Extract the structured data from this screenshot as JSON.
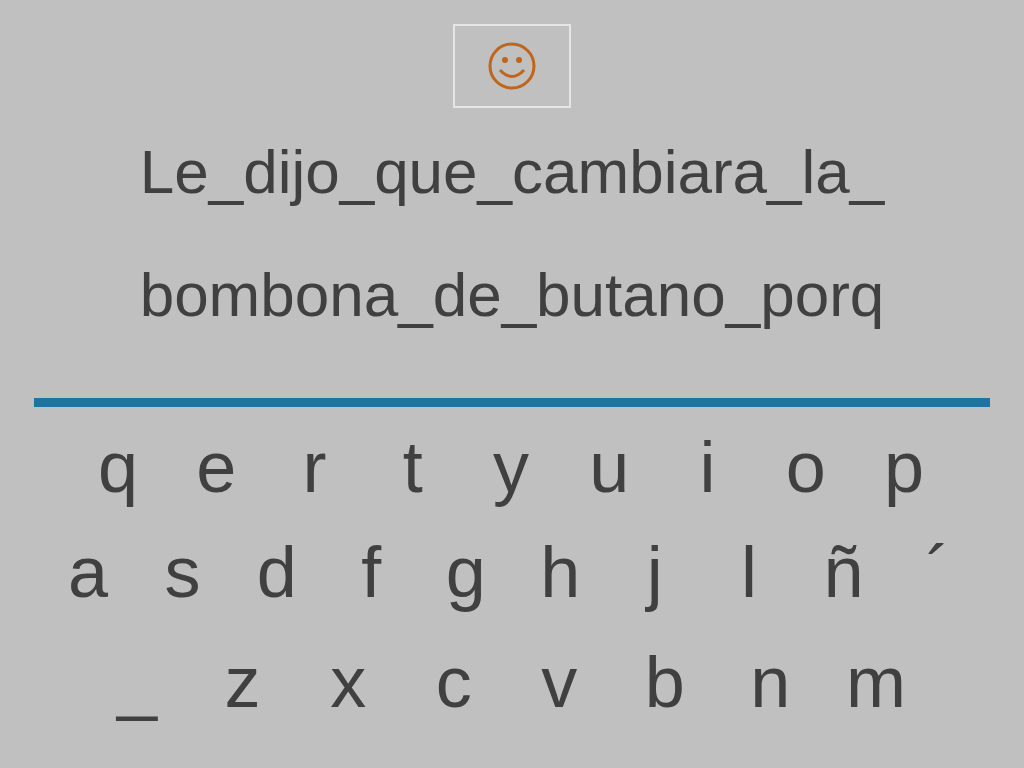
{
  "sentence_lines": [
    "Le_dijo_que_cambiara_la_",
    "bombona_de_butano_porq"
  ],
  "keyboard": {
    "rows": [
      [
        "q",
        "e",
        "r",
        "t",
        "y",
        "u",
        "i",
        "o",
        "p"
      ],
      [
        "a",
        "s",
        "d",
        "f",
        "g",
        "h",
        "j",
        "l",
        "ñ",
        "´"
      ],
      [
        "_",
        "z",
        "x",
        "c",
        "v",
        "b",
        "n",
        "m"
      ]
    ]
  }
}
